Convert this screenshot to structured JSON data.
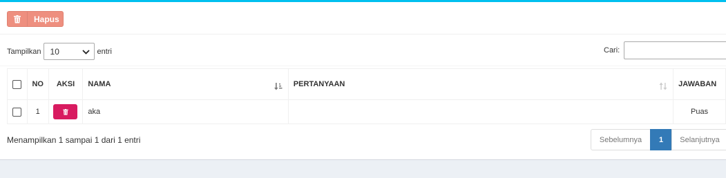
{
  "toolbar": {
    "delete_label": "Hapus"
  },
  "length_menu": {
    "prefix": "Tampilkan",
    "value": "10",
    "suffix": "entri"
  },
  "search": {
    "label": "Cari:",
    "value": ""
  },
  "table": {
    "headers": {
      "no": "NO",
      "aksi": "AKSI",
      "nama": "NAMA",
      "pertanyaan": "PERTANYAAN",
      "jawaban": "JAWABAN"
    },
    "rows": [
      {
        "no": "1",
        "nama": "aka",
        "pertanyaan": "",
        "jawaban": "Puas"
      }
    ]
  },
  "info": "Menampilkan 1 sampai 1 dari 1 entri",
  "pagination": {
    "prev": "Sebelumnya",
    "current": "1",
    "next": "Selanjutnya"
  },
  "colors": {
    "accent_top": "#00c0ef",
    "delete_btn": "#ee8f7f",
    "row_delete_btn": "#d81b60",
    "page_active": "#337ab7"
  },
  "icons": {
    "delete": "trash-icon",
    "select": "chevron-down-icon",
    "sort": "sort-icon"
  }
}
